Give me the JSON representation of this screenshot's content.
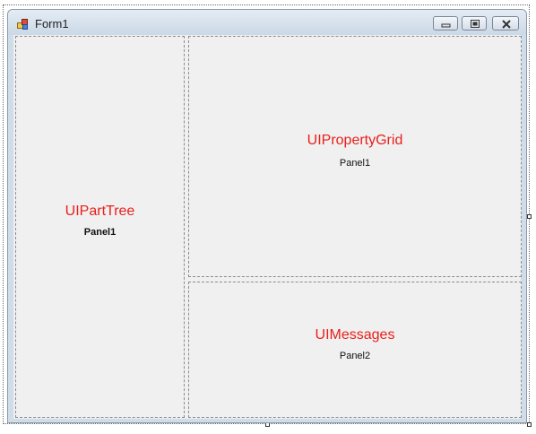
{
  "window": {
    "title": "Form1",
    "icon": "form-icon"
  },
  "caption_buttons": [
    {
      "name": "minimize",
      "icon": "minimize-icon"
    },
    {
      "name": "maximize",
      "icon": "maximize-icon"
    },
    {
      "name": "close",
      "icon": "close-icon"
    }
  ],
  "panels": {
    "left": {
      "control": "UIPartTree",
      "label": "Panel1"
    },
    "right_top": {
      "control": "UIPropertyGrid",
      "label": "Panel1"
    },
    "right_bottom": {
      "control": "UIMessages",
      "label": "Panel2"
    }
  },
  "colors": {
    "control_text": "#e8201c",
    "client_background": "#f0f0f0"
  }
}
